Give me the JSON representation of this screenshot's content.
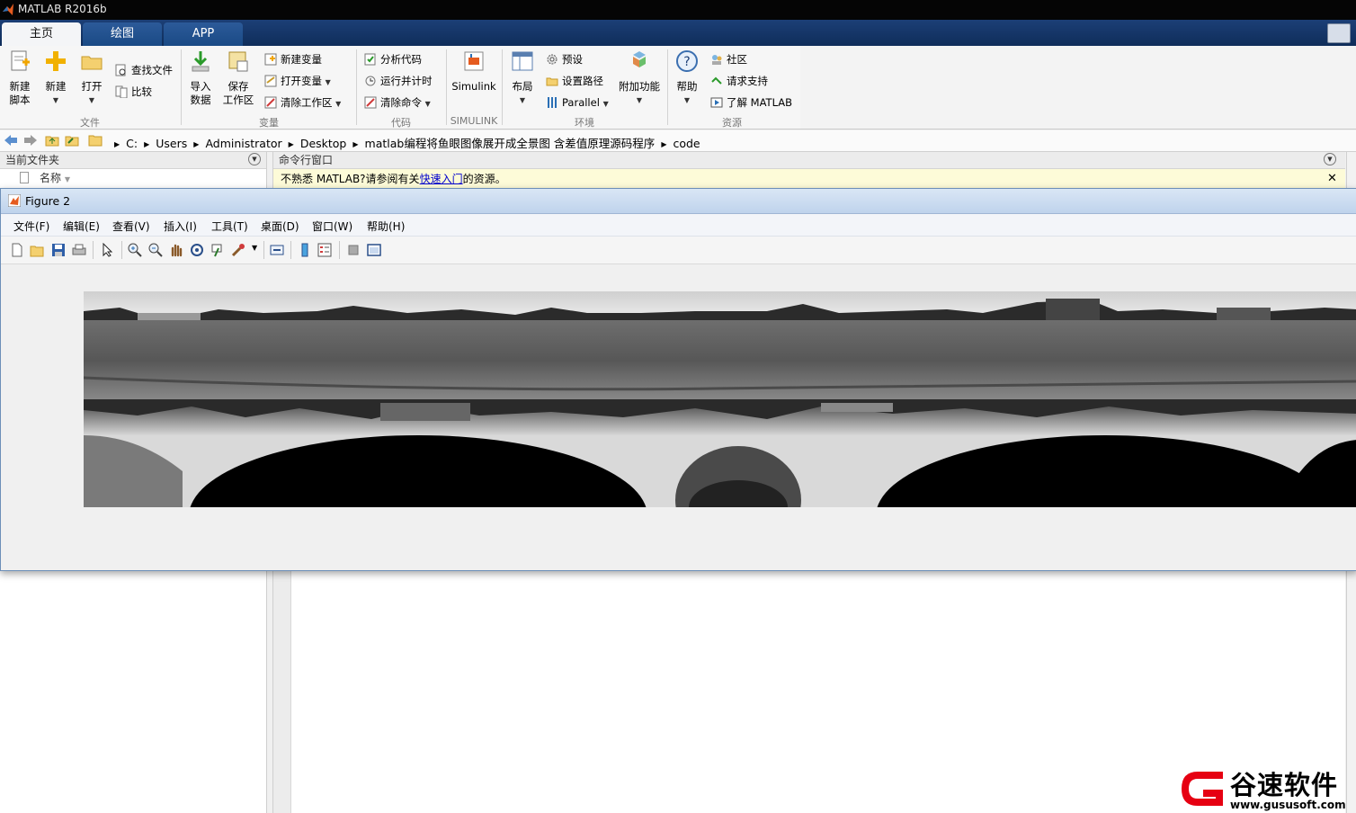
{
  "window": {
    "title": "MATLAB R2016b"
  },
  "ribbon_tabs": [
    "主页",
    "绘图",
    "APP"
  ],
  "ribbon": {
    "file": {
      "group": "文件",
      "new_script": "新建\n脚本",
      "new": "新建",
      "open": "打开",
      "find_files": "查找文件",
      "compare": "比较"
    },
    "variable": {
      "group": "变量",
      "import": "导入\n数据",
      "save_ws": "保存\n工作区",
      "new_var": "新建变量",
      "open_var": "打开变量",
      "clear_ws": "清除工作区"
    },
    "code": {
      "group": "代码",
      "analyze": "分析代码",
      "run_time": "运行并计时",
      "clear_cmd": "清除命令"
    },
    "simulink": {
      "group": "SIMULINK",
      "label": "Simulink"
    },
    "env": {
      "group": "环境",
      "layout": "布局",
      "prefs": "预设",
      "set_path": "设置路径",
      "parallel": "Parallel",
      "addons": "附加功能"
    },
    "resources": {
      "group": "资源",
      "help": "帮助",
      "community": "社区",
      "support": "请求支持",
      "learn": "了解 MATLAB"
    }
  },
  "address": {
    "crumbs": [
      "C:",
      "Users",
      "Administrator",
      "Desktop",
      "matlab编程将鱼眼图像展开成全景图 含差值原理源码程序",
      "code"
    ]
  },
  "left_panel": {
    "title": "当前文件夹",
    "column": "名称"
  },
  "command_window": {
    "title": "命令行窗口",
    "banner_prefix": "不熟悉 MATLAB?请参阅有关",
    "banner_link": "快速入门",
    "banner_suffix": "的资源。"
  },
  "figure": {
    "title": "Figure 2",
    "menu": [
      "文件(F)",
      "编辑(E)",
      "查看(V)",
      "插入(I)",
      "工具(T)",
      "桌面(D)",
      "窗口(W)",
      "帮助(H)"
    ]
  },
  "watermark": {
    "brand": "谷速软件",
    "url": "www.gususoft.com"
  },
  "colors": {
    "titlebar": "#050505",
    "tabbar": "#1c3f77",
    "accent": "#0b5bbf",
    "watermark_red": "#e60012"
  }
}
